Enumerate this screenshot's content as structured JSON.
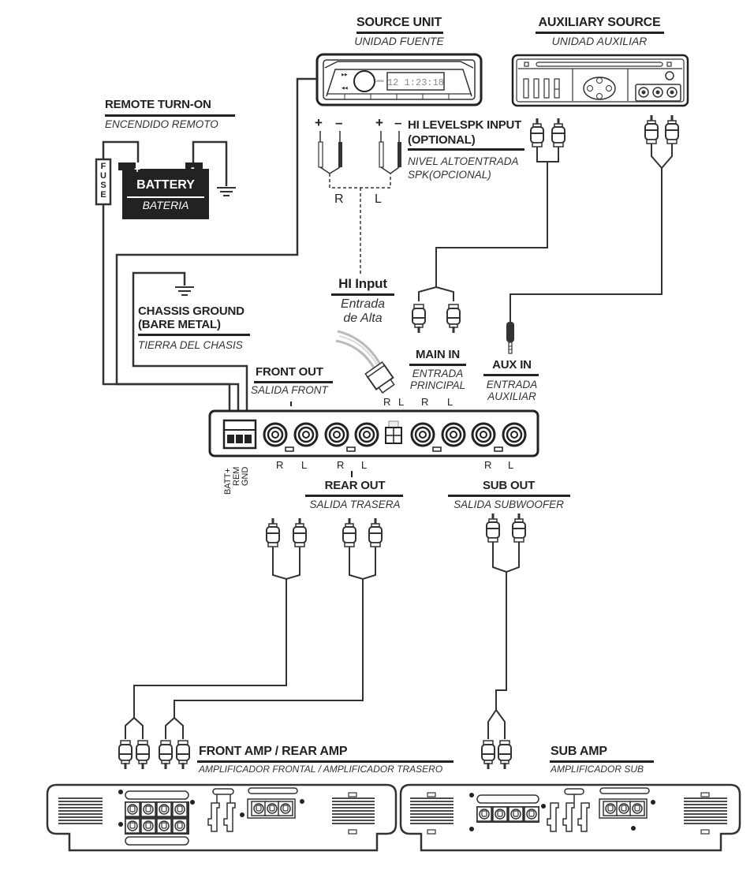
{
  "source_unit": {
    "title": "SOURCE UNIT",
    "subtitle": "UNIDAD FUENTE",
    "display_text": "12 1:23:18",
    "brand_text": "TORRE"
  },
  "aux_source": {
    "title": "AUXILIARY SOURCE",
    "subtitle": "UNIDAD AUXILIAR"
  },
  "remote": {
    "title": "REMOTE TURN-ON",
    "subtitle": "ENCENDIDO REMOTO"
  },
  "battery": {
    "title": "BATTERY",
    "subtitle": "BATERIA",
    "plus": "+",
    "minus": "-",
    "fuse": "FUSE"
  },
  "hi_level": {
    "title_line1": "HI LEVELSPK INPUT",
    "title_line2": "(OPTIONAL)",
    "subtitle_line1": "NIVEL ALTOENTRADA",
    "subtitle_line2": "SPK(OPCIONAL)",
    "r_label": "R",
    "l_label": "L",
    "plus": "+",
    "minus": "–"
  },
  "chassis": {
    "title_line1": "CHASSIS GROUND",
    "title_line2": "(BARE METAL)",
    "subtitle": "TIERRA DEL CHASIS"
  },
  "hi_input": {
    "title": "HI Input",
    "subtitle_line1": "Entrada",
    "subtitle_line2": "de Alta"
  },
  "main_in": {
    "title": "MAIN IN",
    "subtitle_line1": "ENTRADA",
    "subtitle_line2": "PRINCIPAL"
  },
  "aux_in": {
    "title": "AUX IN",
    "subtitle_line1": "ENTRADA",
    "subtitle_line2": "AUXILIAR"
  },
  "front_out": {
    "title": "FRONT OUT",
    "subtitle": "SALIDA FRONT"
  },
  "rear_out": {
    "title": "REAR OUT",
    "subtitle": "SALIDA TRASERA"
  },
  "sub_out": {
    "title": "SUB OUT",
    "subtitle": "SALIDA SUBWOOFER"
  },
  "processor": {
    "power_terminals": [
      "BATT+",
      "REM",
      "GND"
    ],
    "top_labels": [
      "R",
      "L",
      "R",
      "L"
    ],
    "bottom_labels": [
      "R",
      "L",
      "R",
      "L",
      "R",
      "L"
    ]
  },
  "front_rear_amp": {
    "title": "FRONT AMP / REAR AMP",
    "subtitle": "AMPLIFICADOR FRONTAL / AMPLIFICADOR TRASERO"
  },
  "sub_amp": {
    "title": "SUB AMP",
    "subtitle": "AMPLIFICADOR SUB"
  },
  "colors": {
    "line": "#333333",
    "dark": "#222222",
    "hi_wire": "#b8bcc0"
  }
}
